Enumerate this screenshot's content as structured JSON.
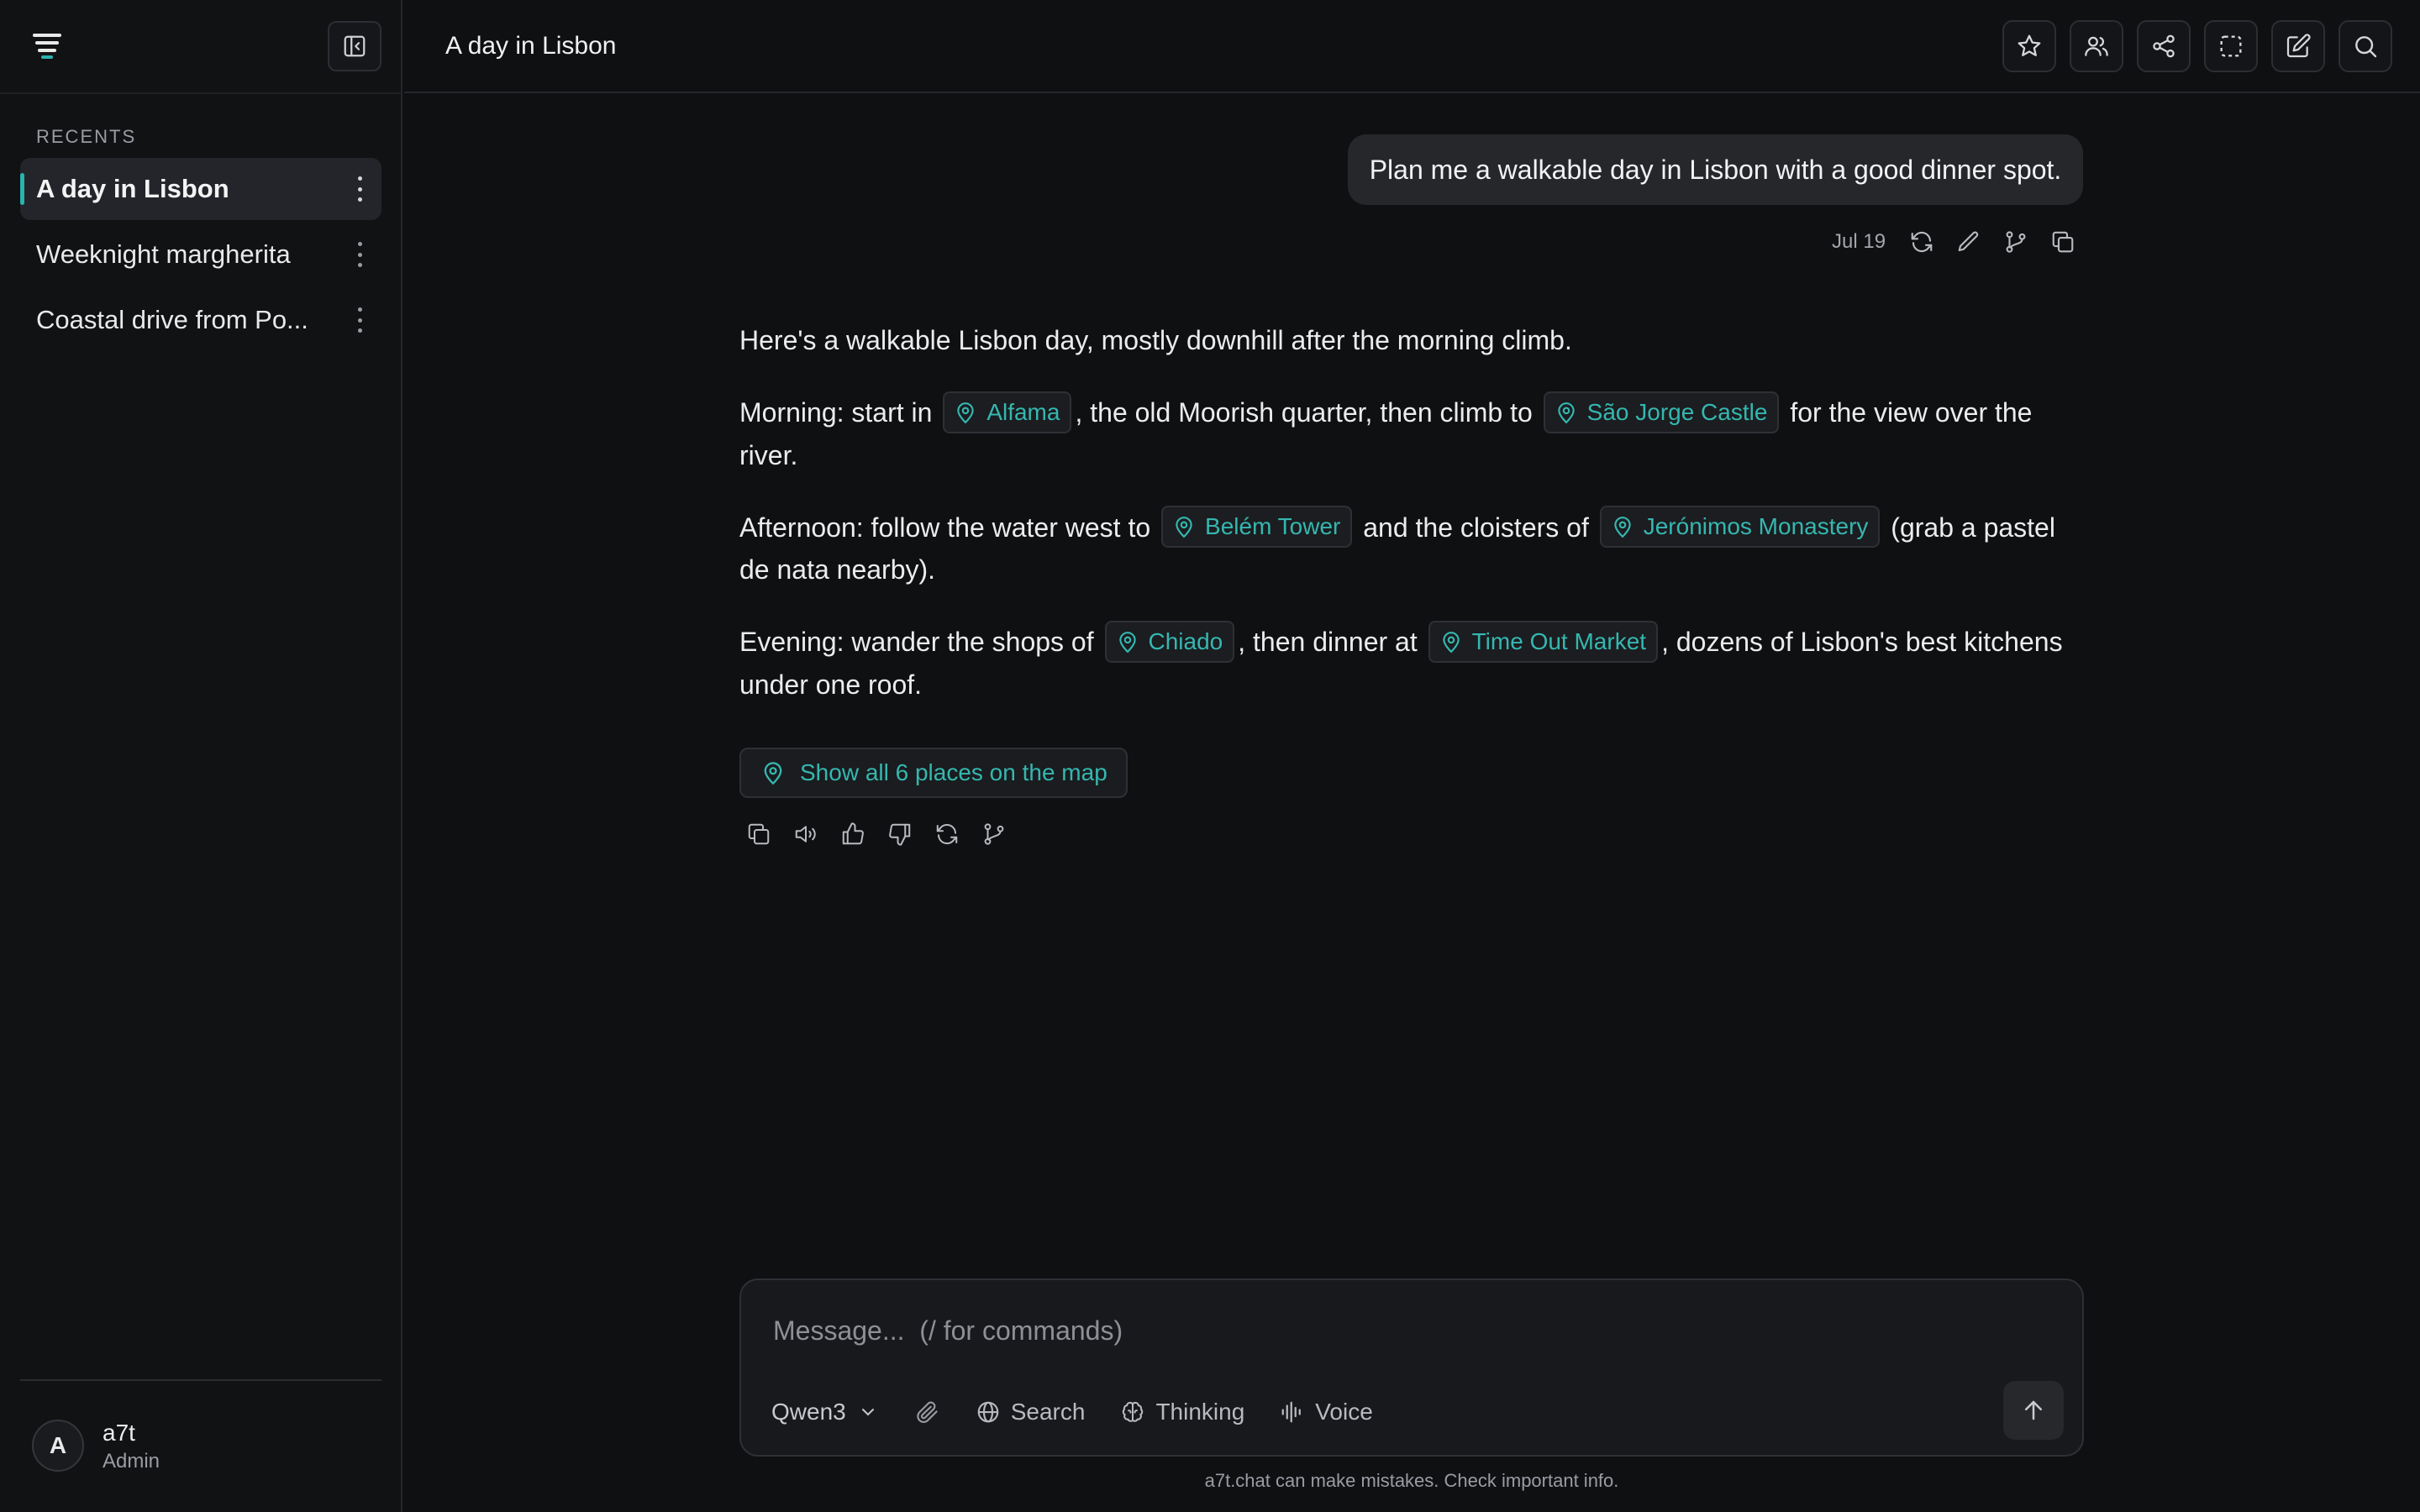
{
  "app": {
    "brand_color": "#2bb3ad",
    "link_color": "#35b7b0",
    "background": "#0f1012"
  },
  "sidebar": {
    "recents_label": "RECENTS",
    "items": [
      {
        "label": "A day in Lisbon",
        "active": true
      },
      {
        "label": "Weeknight margherita",
        "active": false
      },
      {
        "label": "Coastal drive from Po...",
        "active": false
      }
    ],
    "user": {
      "initial": "A",
      "name": "a7t",
      "role": "Admin"
    }
  },
  "header": {
    "title": "A day in Lisbon",
    "icons": [
      "star-icon",
      "users-icon",
      "share-icon",
      "select-icon",
      "edit-icon",
      "search-icon"
    ]
  },
  "conversation": {
    "user_message": "Plan me a walkable day in Lisbon with a good dinner spot.",
    "user_message_date": "Jul 19",
    "assistant": {
      "intro": "Here's a walkable Lisbon day, mostly downhill after the morning climb.",
      "morning": {
        "t1": "Morning: start in",
        "place1": "Alfama",
        "t2": ", the old Moorish quarter, then climb to",
        "place2": "São Jorge Castle",
        "t3": "for the view over the river."
      },
      "afternoon": {
        "t1": "Afternoon: follow the water west to",
        "place1": "Belém Tower",
        "t2": "and the cloisters of",
        "place2": "Jerónimos Monastery",
        "t3": "(grab a pastel de nata nearby)."
      },
      "evening": {
        "t1": "Evening: wander the shops of",
        "place1": "Chiado",
        "t2": ", then dinner at",
        "place2": "Time Out Market",
        "t3": ", dozens of Lisbon's best kitchens under one roof."
      },
      "map_button": "Show all 6 places on the map"
    }
  },
  "composer": {
    "placeholder": "Message...  (/ for commands)",
    "model": "Qwen3",
    "search_label": "Search",
    "thinking_label": "Thinking",
    "voice_label": "Voice"
  },
  "footer": {
    "disclaimer": "a7t.chat can make mistakes. Check important info."
  }
}
